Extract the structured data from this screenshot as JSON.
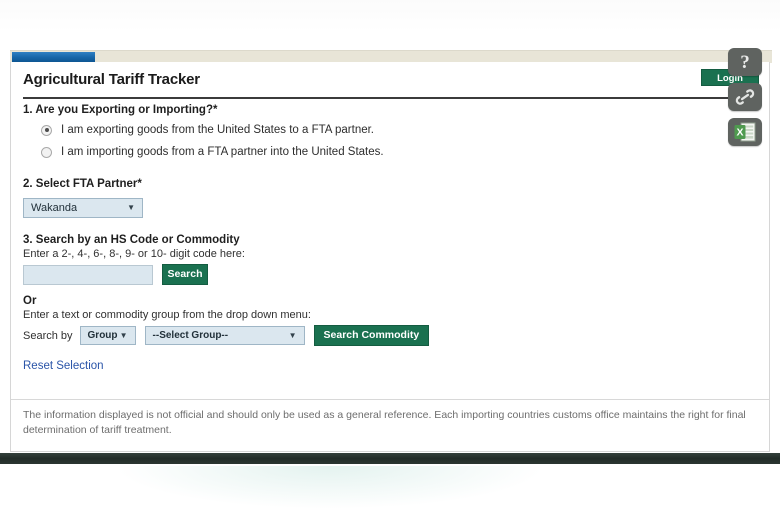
{
  "app": {
    "title": "Agricultural Tariff Tracker",
    "login_label": "Login",
    "accent_green": "#1a7150",
    "progress_blue": "#1565a8",
    "link_blue": "#2a54a8"
  },
  "form": {
    "step1": {
      "label": "1. Are you Exporting or Importing?*",
      "options": [
        {
          "label": "I am exporting goods from the United States to a FTA partner.",
          "selected": true
        },
        {
          "label": "I am importing goods from a FTA partner into the United States.",
          "selected": false
        }
      ]
    },
    "step2": {
      "label": "2. Select FTA Partner*",
      "partner_value": "Wakanda",
      "caret": "▼"
    },
    "step3": {
      "label": "3. Search by an HS Code or Commodity",
      "helper": "Enter a 2-, 4-, 6-, 8-, 9- or 10- digit code here:",
      "code_value": "",
      "code_placeholder": "",
      "search_label": "Search",
      "or_label": "Or",
      "menu_helper": "Enter a text or commodity group from the drop down menu:",
      "search_by_label": "Search by",
      "group_by_value": "Group",
      "group_value": "--Select Group--",
      "search_commodity_label": "Search Commodity"
    },
    "reset_label": "Reset Selection"
  },
  "disclaimer": "The information displayed is not official and should only be used as a general reference. Each importing countries customs office maintains the right for final determination of tariff treatment.",
  "icons": {
    "help": {
      "name": "help-icon",
      "glyph": "?"
    },
    "link": {
      "name": "link-icon"
    },
    "excel": {
      "name": "excel-export-icon",
      "glyph": "X"
    }
  }
}
